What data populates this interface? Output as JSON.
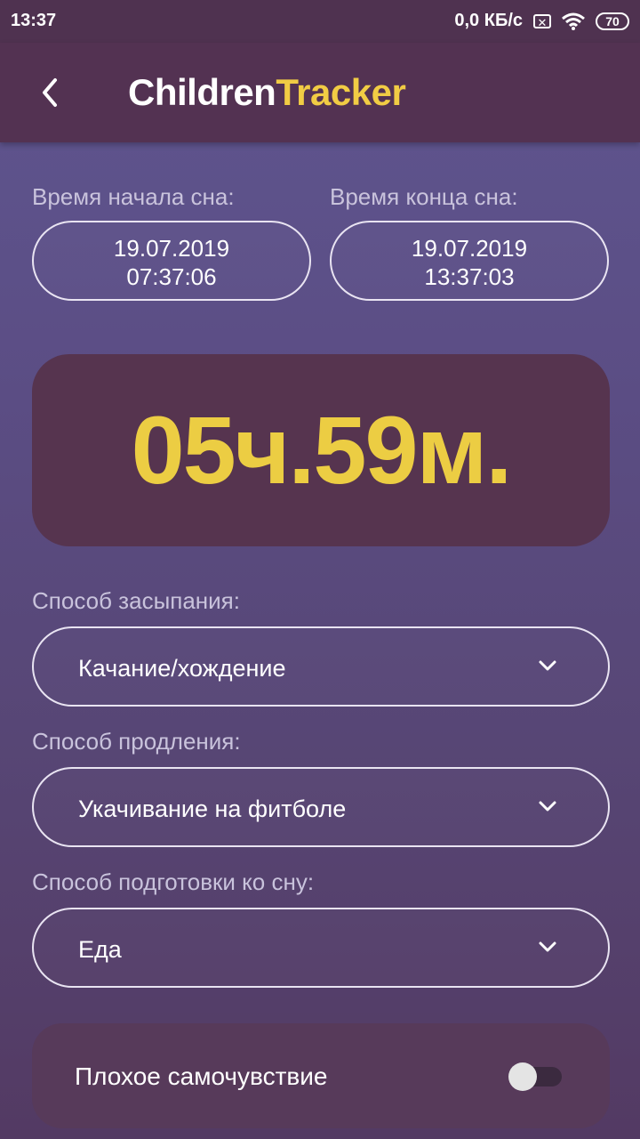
{
  "status_bar": {
    "time": "13:37",
    "net_speed": "0,0 КБ/с",
    "battery": "70",
    "icons": [
      "sim-x-icon",
      "wifi-icon",
      "battery-icon"
    ]
  },
  "app_bar": {
    "title_part1": "Children",
    "title_part2": "Tracker",
    "back_icon": "back-arrow-icon"
  },
  "sleep_start": {
    "label": "Время начала сна:",
    "date": "19.07.2019",
    "time": "07:37:06"
  },
  "sleep_end": {
    "label": "Время конца сна:",
    "date": "19.07.2019",
    "time": "13:37:03"
  },
  "duration": "05ч.59м.",
  "fall_asleep": {
    "label": "Способ засыпания:",
    "value": "Качание/хождение"
  },
  "prolong": {
    "label": "Способ продления:",
    "value": "Укачивание на фитболе"
  },
  "preparation": {
    "label": "Способ подготовки ко сну:",
    "value": "Еда"
  },
  "unwell": {
    "label": "Плохое самочувствие",
    "on": false
  },
  "colors": {
    "accent": "#f1cc44",
    "app_bar": "#533252",
    "duration_card": "#56344f"
  }
}
